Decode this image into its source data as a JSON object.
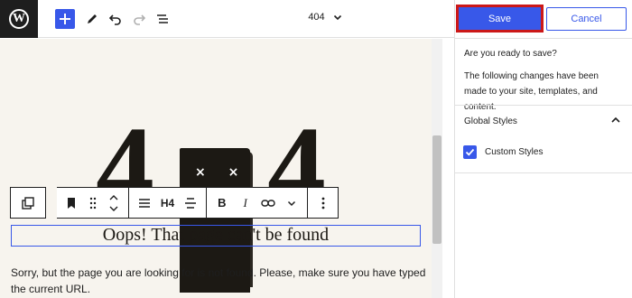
{
  "topbar": {
    "logo_letter": "W",
    "add_icon": "plus-icon",
    "doc_title": "404"
  },
  "canvas": {
    "digit_left": "4",
    "digit_right": "4",
    "face_eyes": "× ×",
    "block_toolbar": {
      "heading_level": "H4",
      "bold": "B",
      "italic": "I"
    },
    "heading_text": "Oops! That page can't be found",
    "paragraph_text": "Sorry, but the page you are looking for is not found. Please, make sure you have typed the current URL."
  },
  "panel": {
    "save_label": "Save",
    "cancel_label": "Cancel",
    "title": "Are you ready to save?",
    "description": "The following changes have been made to your site, templates, and content.",
    "section_label": "Global Styles",
    "item_label": "Custom Styles",
    "item_checked": true
  },
  "colors": {
    "accent": "#3858e9",
    "save_highlight": "#cc1818",
    "canvas_bg": "#f7f4ee"
  }
}
